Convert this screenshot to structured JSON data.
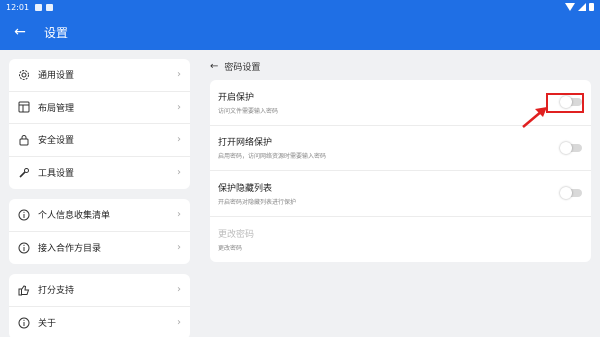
{
  "status_bar": {
    "time": "12:01"
  },
  "app_bar": {
    "title": "设置"
  },
  "left_menu": {
    "group1": [
      {
        "label": "通用设置",
        "icon": "gear-icon"
      },
      {
        "label": "布局管理",
        "icon": "layout-icon"
      },
      {
        "label": "安全设置",
        "icon": "lock-icon"
      },
      {
        "label": "工具设置",
        "icon": "wrench-icon"
      }
    ],
    "group2": [
      {
        "label": "个人信息收集清单",
        "icon": "info-icon"
      },
      {
        "label": "接入合作方目录",
        "icon": "info-icon"
      }
    ],
    "group3": [
      {
        "label": "打分支持",
        "icon": "thumbs-up-icon"
      },
      {
        "label": "关于",
        "icon": "info-icon"
      }
    ]
  },
  "password_settings": {
    "breadcrumb": "密码设置",
    "items": [
      {
        "title": "开启保护",
        "subtitle": "访问文件需要输入密码",
        "enabled": false
      },
      {
        "title": "打开网络保护",
        "subtitle": "启用密码，访问网络资源时需要输入密码",
        "enabled": false
      },
      {
        "title": "保护隐藏列表",
        "subtitle": "开启密码对隐藏列表进行保护",
        "enabled": false
      },
      {
        "title": "更改密码",
        "subtitle": "更改密码"
      }
    ]
  },
  "colors": {
    "primary": "#1f6fe5",
    "highlight": "#e02020"
  }
}
